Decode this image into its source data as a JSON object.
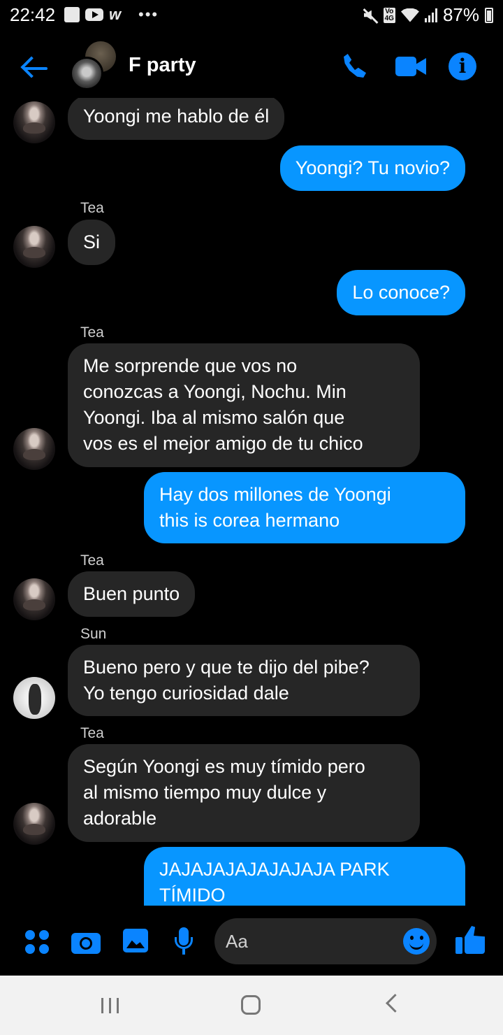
{
  "status_bar": {
    "time": "22:42",
    "battery_percent": "87%",
    "network_label": "4G",
    "icons": [
      "gallery-icon",
      "youtube-icon",
      "wattpad-icon",
      "more-dots-icon",
      "mute-icon",
      "volte-icon",
      "wifi-icon",
      "signal-icon",
      "battery-icon"
    ]
  },
  "header": {
    "title": "F party",
    "icons": [
      "back-arrow-icon",
      "phone-icon",
      "video-camera-icon",
      "info-icon"
    ]
  },
  "messages": [
    {
      "sender": "",
      "direction": "in",
      "lines": [
        "Yoongi me hablo de él"
      ],
      "avatar": "tea"
    },
    {
      "sender": "",
      "direction": "out",
      "lines": [
        "Yoongi? Tu novio?"
      ]
    },
    {
      "sender": "Tea",
      "direction": "in",
      "lines": [
        "Si"
      ],
      "avatar": "tea"
    },
    {
      "sender": "",
      "direction": "out",
      "lines": [
        "Lo conoce?"
      ]
    },
    {
      "sender": "Tea",
      "direction": "in",
      "lines": [
        "Me sorprende que vos no",
        "conozcas a Yoongi, Nochu. Min",
        "Yoongi. Iba al mismo salón que",
        "vos es el mejor amigo de tu chico"
      ],
      "avatar": "tea"
    },
    {
      "sender": "",
      "direction": "out",
      "lines": [
        "Hay dos millones de Yoongi",
        "this is corea hermano"
      ]
    },
    {
      "sender": "Tea",
      "direction": "in",
      "lines": [
        "Buen punto"
      ],
      "avatar": "tea"
    },
    {
      "sender": "Sun",
      "direction": "in",
      "lines": [
        "Bueno pero y que te dijo del pibe?",
        "Yo tengo curiosidad dale"
      ],
      "avatar": "sun"
    },
    {
      "sender": "Tea",
      "direction": "in",
      "lines": [
        "Según Yoongi es muy tímido pero",
        "al mismo tiempo muy dulce y",
        "adorable"
      ],
      "avatar": "tea"
    },
    {
      "sender": "",
      "direction": "out",
      "lines": [
        "JAJAJAJAJAJAJAJA PARK",
        "TÍMIDO"
      ]
    }
  ],
  "composer": {
    "placeholder": "Aa",
    "icons": [
      "apps-icon",
      "camera-icon",
      "gallery-icon",
      "microphone-icon",
      "emoji-icon",
      "thumbs-up-icon"
    ]
  },
  "nav_bar": {
    "icons": [
      "recent-apps-icon",
      "home-icon",
      "back-icon"
    ]
  },
  "colors": {
    "background": "#000000",
    "accent": "#0a84ff",
    "outgoing_bubble": "#0896ff",
    "incoming_bubble": "#262626"
  }
}
